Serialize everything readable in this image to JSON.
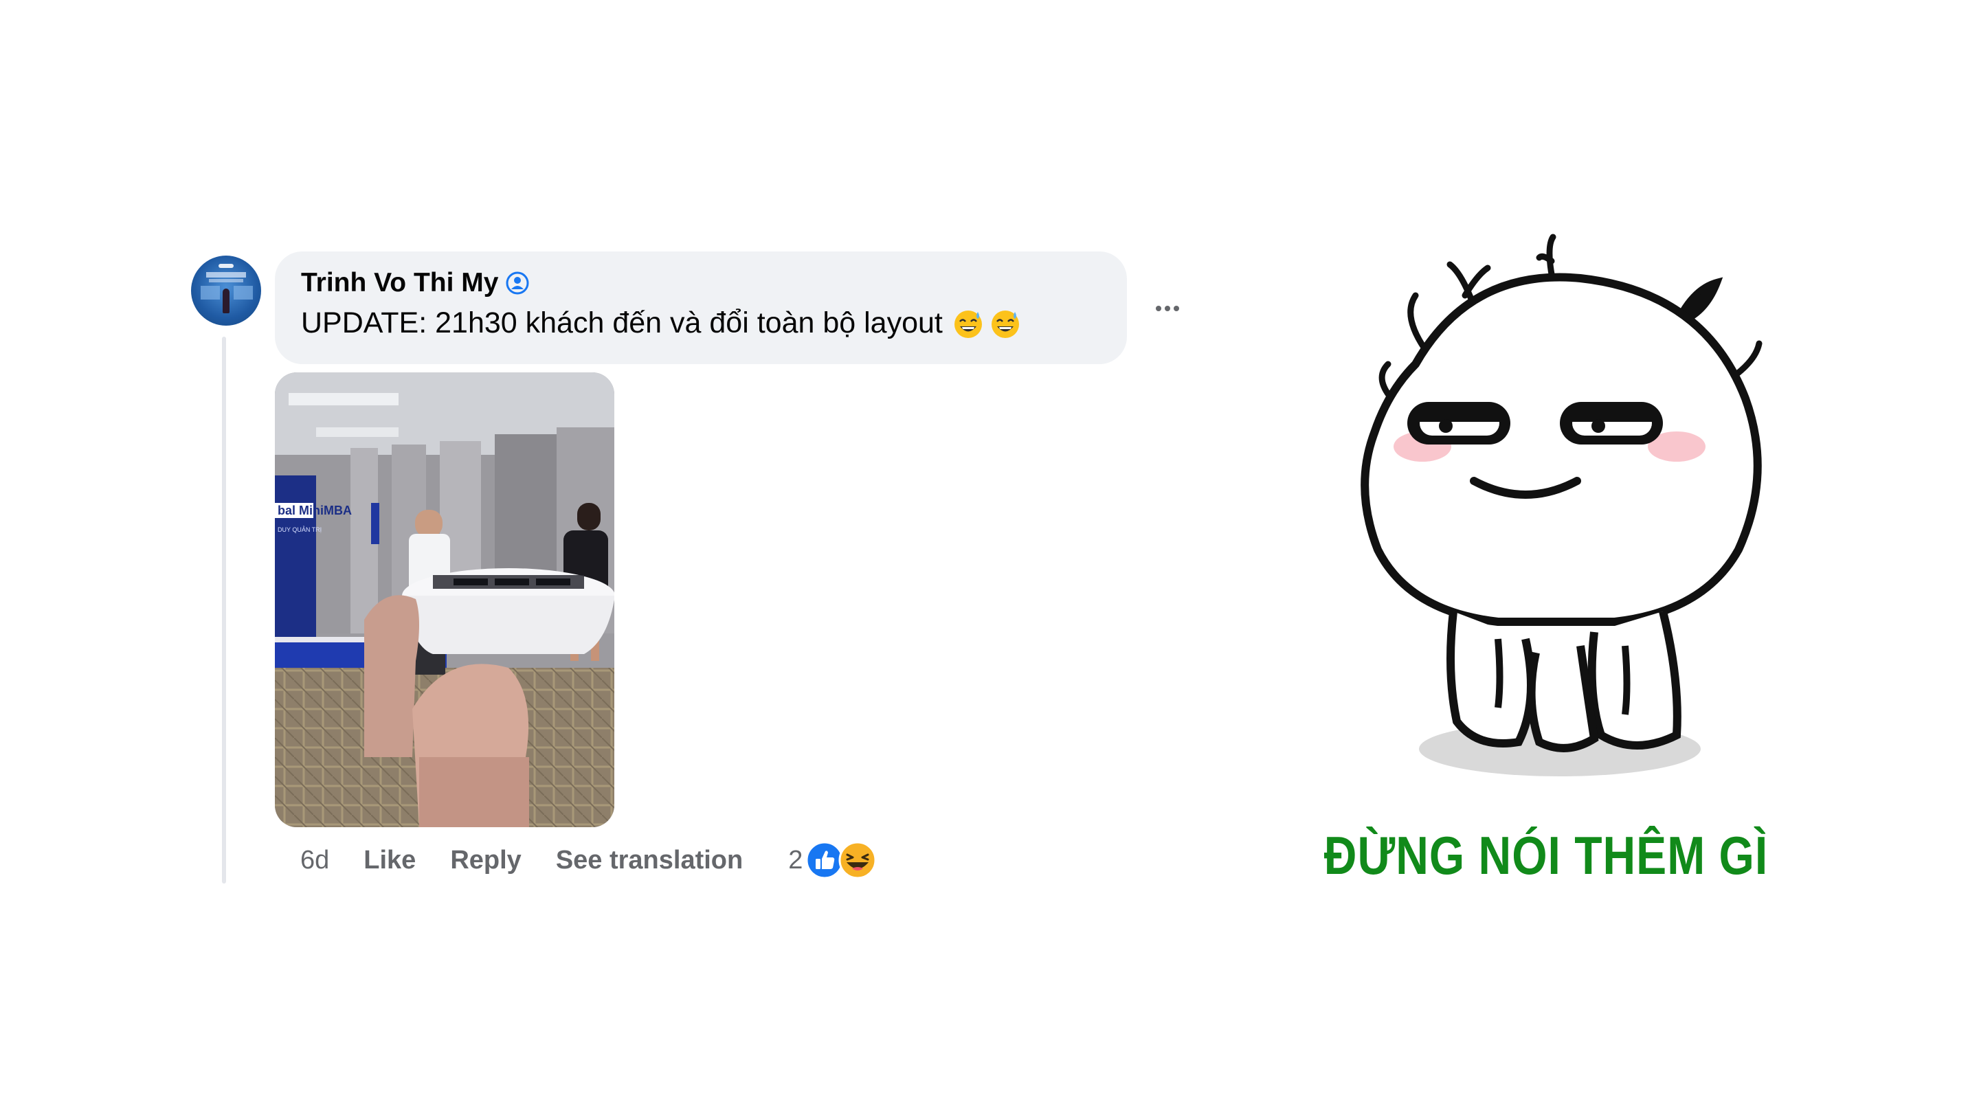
{
  "comment": {
    "author": "Trinh Vo Thi My",
    "text": "UPDATE: 21h30 khách đến và đổi toàn bộ layout",
    "emojis": [
      "grinning-sweat-emoji",
      "grinning-sweat-emoji"
    ],
    "photo": {
      "alt_banner_text": "bal MiniMBA",
      "alt_banner_sub": "DUY QUẢN TRỊ"
    },
    "actions": {
      "time": "6d",
      "like": "Like",
      "reply": "Reply",
      "see_translation": "See translation"
    },
    "reactions": {
      "count": "2",
      "icons": [
        "like-icon",
        "haha-icon"
      ]
    }
  },
  "meme": {
    "caption": "ĐỪNG NÓI THÊM GÌ"
  },
  "colors": {
    "bubble": "#f0f2f5",
    "secondary_text": "#65676b",
    "like_blue": "#1877f2",
    "caption_green": "#118a1a"
  }
}
